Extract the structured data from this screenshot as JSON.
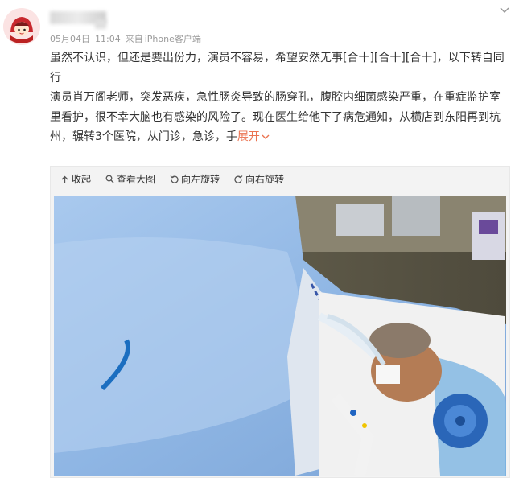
{
  "post": {
    "date": "05月04日",
    "time": "11:04",
    "source_prefix": "来自",
    "source": "iPhone客户端",
    "paragraph1": "虽然不认识，但还是要出份力，演员不容易，希望安然无事[合十][合十][合十]，以下转自同行",
    "paragraph2": "演员肖万阁老师，突发恶疾，急性肠炎导致的肠穿孔，腹腔内细菌感染严重，在重症监护室里看护，很不幸大脑也有感染的风险了。现在医生给他下了病危通知，从横店到东阳再到杭州，辗转3个医院，从门诊，急诊，手",
    "expand_label": "展开"
  },
  "toolbar": {
    "collapse": "收起",
    "view_large": "查看大图",
    "rotate_left": "向左旋转",
    "rotate_right": "向右旋转"
  },
  "colors": {
    "link": "#eb7350",
    "meta": "#9a9a9a",
    "text": "#333333"
  }
}
